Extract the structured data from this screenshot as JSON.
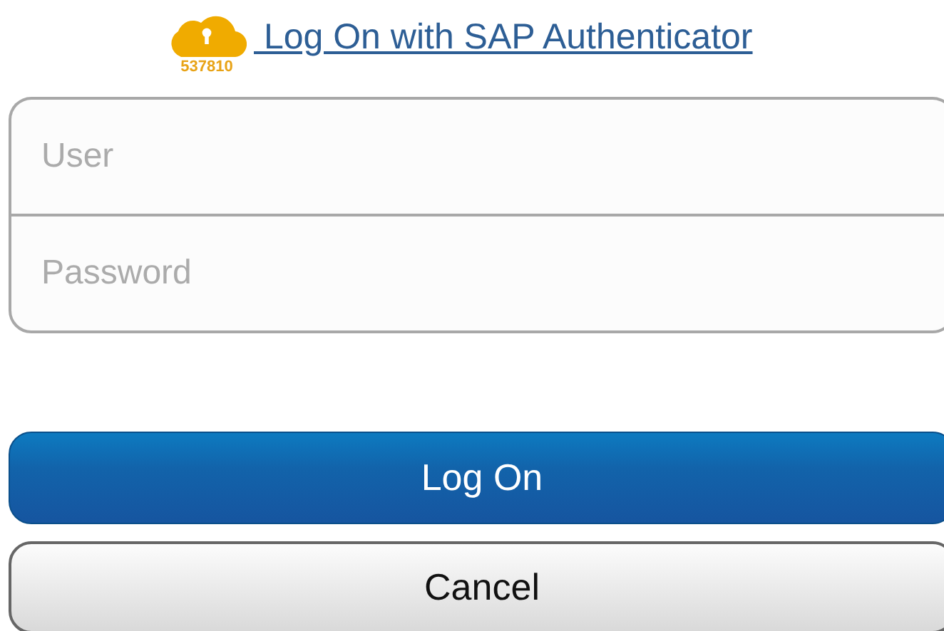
{
  "authenticator": {
    "code": "537810",
    "link": " Log On with SAP Authenticator"
  },
  "fields": [
    {
      "placeholder": "User"
    },
    {
      "placeholder": "Password"
    }
  ],
  "buttons": [
    {
      "label": "Log On",
      "kind": "primary"
    },
    {
      "label": "Cancel",
      "kind": "secondary"
    }
  ]
}
